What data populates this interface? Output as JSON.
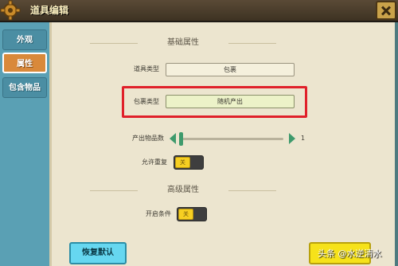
{
  "window": {
    "title": "道具编辑"
  },
  "sidebar": {
    "tabs": [
      {
        "label": "外观",
        "active": false
      },
      {
        "label": "属性",
        "active": true
      },
      {
        "label": "包含物品",
        "active": false
      }
    ]
  },
  "main": {
    "basic_section_title": "基础属性",
    "item_type": {
      "label": "道具类型",
      "value": "包裹"
    },
    "pack_type": {
      "label": "包裹类型",
      "value": "随机产出"
    },
    "output_count": {
      "label": "产出物品数",
      "value": "1"
    },
    "allow_repeat": {
      "label": "允许重复",
      "toggle_text": "关"
    },
    "advanced_section_title": "高级属性",
    "open_condition": {
      "label": "开启条件",
      "toggle_text": "关"
    }
  },
  "footer": {
    "reset_button": "恢复默认",
    "watermark": "头条 @水逆清水"
  },
  "colors": {
    "accent_highlight": "#e0202a",
    "sidebar": "#5aa0b4",
    "active_tab": "#d9893a",
    "slider": "#3e9a6c",
    "toggle_knob": "#f6cf22",
    "reset_button": "#66d7f0",
    "confirm_button": "#f6e21a"
  },
  "icons": {
    "header": "gear-icon",
    "close": "close-icon"
  }
}
